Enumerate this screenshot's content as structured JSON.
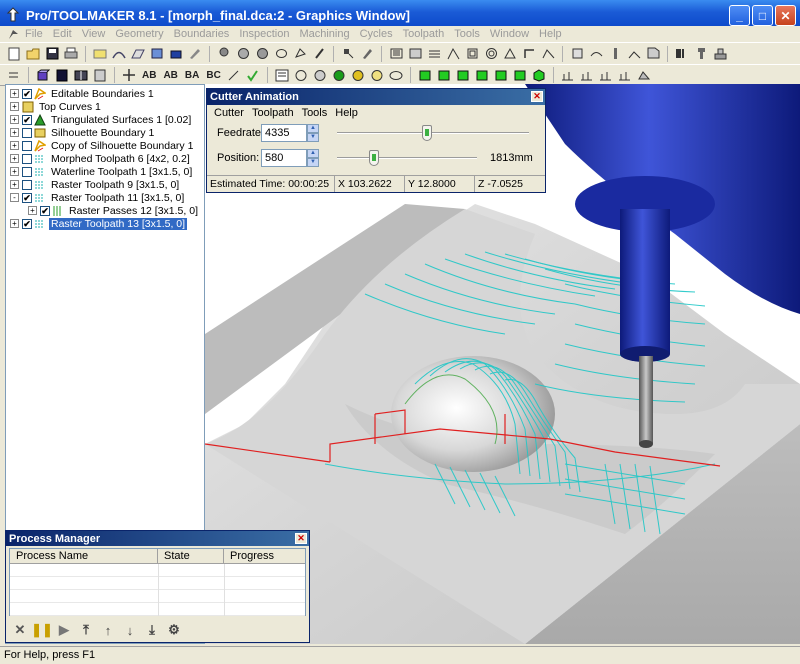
{
  "window": {
    "title": "Pro/TOOLMAKER 8.1 - [morph_final.dca:2 - Graphics Window]",
    "min_glyph": "_",
    "max_glyph": "□",
    "close_glyph": "✕"
  },
  "menu": [
    "File",
    "Edit",
    "View",
    "Geometry",
    "Boundaries",
    "Inspection",
    "Machining",
    "Cycles",
    "Toolpath",
    "Tools",
    "Window",
    "Help"
  ],
  "toolbar2_text": {
    "ab1": "AB",
    "ab2": "AB",
    "ba": "BA",
    "bc": "BC"
  },
  "tree": {
    "items": [
      {
        "label": "Editable Boundaries 1",
        "expander": "+",
        "checked": "✔",
        "icon": "boundary-icon"
      },
      {
        "label": "Top Curves 1",
        "expander": "+",
        "checked": "",
        "icon": "curves-icon"
      },
      {
        "label": "Triangulated Surfaces 1 [0.02]",
        "expander": "+",
        "checked": "✔",
        "icon": "triangle-icon"
      },
      {
        "label": "Silhouette Boundary 1",
        "expander": "+",
        "checked": "",
        "icon": "boundary-icon"
      },
      {
        "label": "Copy of Silhouette Boundary 1",
        "expander": "+",
        "checked": "",
        "icon": "boundary-icon"
      },
      {
        "label": "Morphed Toolpath 6 [4x2, 0.2]",
        "expander": "+",
        "checked": "",
        "icon": "toolpath-icon"
      },
      {
        "label": "Waterline Toolpath 1 [3x1.5, 0]",
        "expander": "+",
        "checked": "",
        "icon": "toolpath-icon"
      },
      {
        "label": "Raster Toolpath 9 [3x1.5, 0]",
        "expander": "+",
        "checked": "",
        "icon": "toolpath-icon"
      },
      {
        "label": "Raster Toolpath 11 [3x1.5, 0]",
        "expander": "-",
        "checked": "✔",
        "icon": "toolpath-icon"
      },
      {
        "label": "Raster Passes 12 [3x1.5, 0]",
        "expander": "+",
        "checked": "✔",
        "icon": "passes-icon"
      },
      {
        "label": "Raster Toolpath 13 [3x1.5, 0]",
        "expander": "+",
        "checked": "✔",
        "icon": "toolpath-icon",
        "selected": true
      }
    ]
  },
  "cutter_animation": {
    "title": "Cutter Animation",
    "menu": [
      "Cutter",
      "Toolpath",
      "Tools",
      "Help"
    ],
    "feedrate_label": "Feedrate:",
    "feedrate_value": "4335",
    "feedrate_slider": 0.47,
    "position_label": "Position:",
    "position_value": "580",
    "position_slider": 0.22,
    "position_mm": "1813mm",
    "estimated_time": "Estimated Time: 00:00:25",
    "x": "X  103.2622",
    "y": "Y  12.8000",
    "z": "Z  -7.0525"
  },
  "process_manager": {
    "title": "Process Manager",
    "columns": [
      "Process Name",
      "State",
      "Progress"
    ],
    "tools": [
      "stop-icon",
      "pause-icon",
      "play-icon",
      "move-top-icon",
      "move-up-icon",
      "move-down-icon",
      "move-bottom-icon",
      "settings-icon"
    ]
  },
  "status": "For Help, press F1",
  "colors": {
    "toolpath": "#1fc7c7",
    "boundary": "#e02020",
    "spindle": "#1c2fa8",
    "tool": "#7a7a7a"
  }
}
